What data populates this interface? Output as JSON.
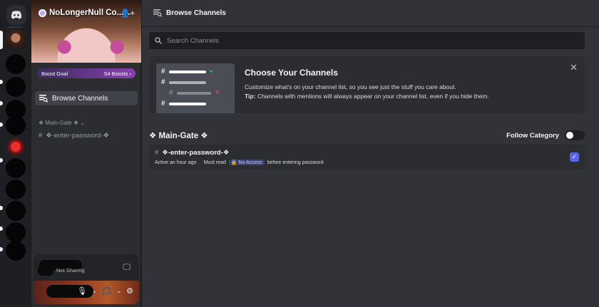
{
  "server": {
    "name": "NoLongerNull Co...",
    "boost_goal_label": "Boost Goal",
    "boost_count": "54 Boosts",
    "browse_label": "Browse Channels",
    "category": "❖ Main-Gate ❖",
    "channel": "❖-enter-password-❖"
  },
  "user_panel": {
    "sharing_status": "Not Sharing"
  },
  "main": {
    "header_title": "Browse Channels",
    "search_placeholder": "Search Channels",
    "card": {
      "title": "Choose Your Channels",
      "description": "Customize what's on your channel list, so you see just the stuff you care about.",
      "tip_label": "Tip:",
      "tip_text": "Channels with mentions will always appear on your channel list, even if you hide them."
    },
    "section": {
      "title": "❖ Main-Gate ❖",
      "follow_label": "Follow Category",
      "follow_on": false
    },
    "channel_row": {
      "name": "❖-enter-password-❖",
      "activity": "Active an hour ago",
      "topic_before": "Must read",
      "mention": "No Access",
      "topic_after": "before entering password",
      "checked": true
    }
  },
  "colors": {
    "accent": "#5865f2",
    "bg_main": "#313338",
    "bg_sidebar": "#2b2d31",
    "bg_rail": "#1e1f22"
  }
}
